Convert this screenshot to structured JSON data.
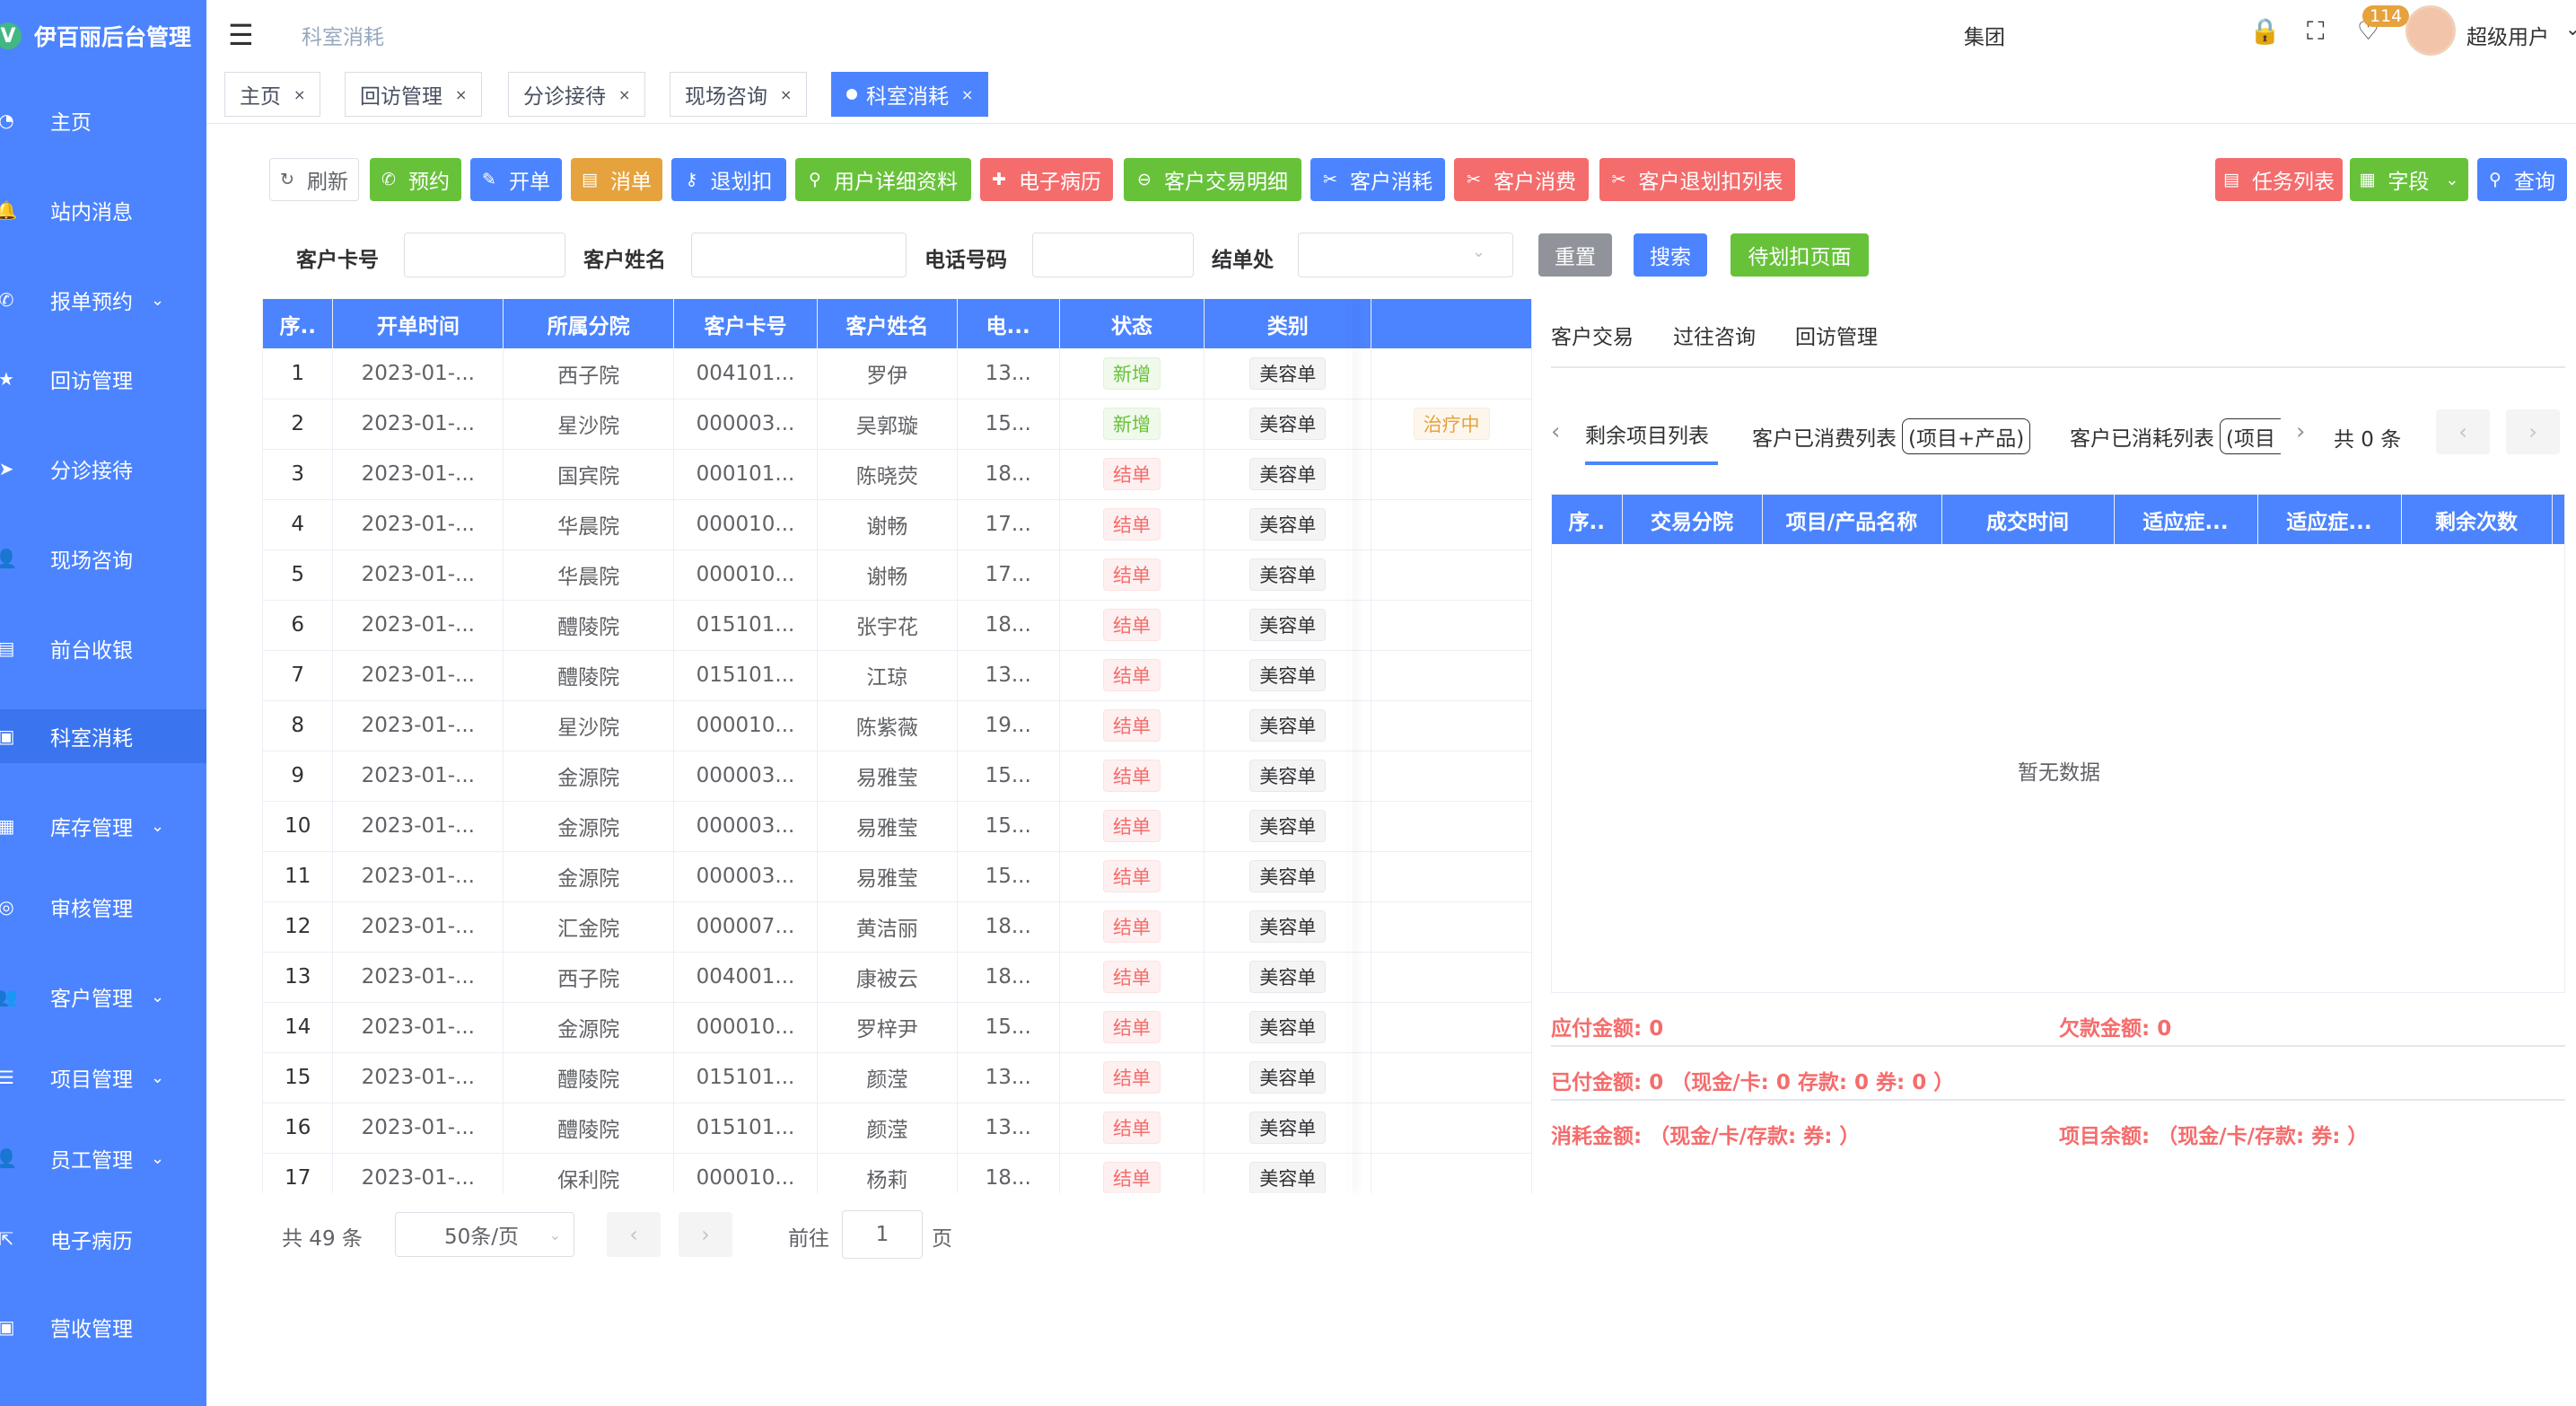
{
  "app": {
    "title": "伊百丽后台管理",
    "logo_letter": "V"
  },
  "sidebar": {
    "items": [
      {
        "label": "主页",
        "icon": "dashboard-icon",
        "glyph": "◔",
        "chev": ""
      },
      {
        "label": "站内消息",
        "icon": "bell-icon",
        "glyph": "🔔",
        "chev": ""
      },
      {
        "label": "报单预约",
        "icon": "phone-icon",
        "glyph": "✆",
        "chev": "⌄"
      },
      {
        "label": "回访管理",
        "icon": "star-icon",
        "glyph": "★",
        "chev": ""
      },
      {
        "label": "分诊接待",
        "icon": "send-icon",
        "glyph": "➤",
        "chev": ""
      },
      {
        "label": "现场咨询",
        "icon": "user-icon",
        "glyph": "👤",
        "chev": ""
      },
      {
        "label": "前台收银",
        "icon": "cashier-icon",
        "glyph": "▤",
        "chev": ""
      },
      {
        "label": "科室消耗",
        "icon": "monitor-icon",
        "glyph": "▣",
        "chev": ""
      },
      {
        "label": "库存管理",
        "icon": "grid-icon",
        "glyph": "▦",
        "chev": "⌄"
      },
      {
        "label": "审核管理",
        "icon": "chat-icon",
        "glyph": "◎",
        "chev": ""
      },
      {
        "label": "客户管理",
        "icon": "customers-icon",
        "glyph": "👥",
        "chev": "⌄"
      },
      {
        "label": "项目管理",
        "icon": "list-icon",
        "glyph": "☰",
        "chev": "⌄"
      },
      {
        "label": "员工管理",
        "icon": "staff-icon",
        "glyph": "👤",
        "chev": "⌄"
      },
      {
        "label": "电子病历",
        "icon": "external-link-icon",
        "glyph": "⇱",
        "chev": ""
      },
      {
        "label": "营收管理",
        "icon": "revenue-icon",
        "glyph": "▣",
        "chev": ""
      }
    ]
  },
  "header": {
    "breadcrumb": "科室消耗",
    "group_label": "集团",
    "badge_count": "114",
    "user_name": "超级用户"
  },
  "tags": [
    {
      "label": "主页"
    },
    {
      "label": "回访管理"
    },
    {
      "label": "分诊接待"
    },
    {
      "label": "现场咨询"
    },
    {
      "label": "科室消耗"
    }
  ],
  "toolbar": {
    "refresh": "刷新",
    "appointment": "预约",
    "open_order": "开单",
    "cancel_order": "消单",
    "refund_deduct": "退划扣",
    "user_detail": "用户详细资料",
    "emr": "电子病历",
    "trade_detail": "客户交易明细",
    "customer_consume": "客户消耗",
    "customer_spend": "客户消费",
    "refund_list": "客户退划扣列表",
    "task_list": "任务列表",
    "fields": "字段",
    "query": "查询"
  },
  "search": {
    "card_label": "客户卡号",
    "card_value": "",
    "name_label": "客户姓名",
    "name_value": "",
    "phone_label": "电话号码",
    "phone_value": "",
    "settle_label": "结单处",
    "settle_value": "",
    "reset": "重置",
    "search": "搜索",
    "pending": "待划扣页面"
  },
  "table": {
    "columns": [
      "序..",
      "开单时间",
      "所属分院",
      "客户卡号",
      "客户姓名",
      "电...",
      "状态",
      "类别",
      ""
    ],
    "rows": [
      {
        "no": "1",
        "time": "2023-01-...",
        "branch": "西子院",
        "card": "004101...",
        "name": "罗伊",
        "phone": "13...",
        "status": "新增",
        "status_type": "new",
        "cat": "美容单",
        "extra": ""
      },
      {
        "no": "2",
        "time": "2023-01-...",
        "branch": "星沙院",
        "card": "000003...",
        "name": "吴郭璇",
        "phone": "15...",
        "status": "新增",
        "status_type": "new",
        "cat": "美容单",
        "extra": "治疗中"
      },
      {
        "no": "3",
        "time": "2023-01-...",
        "branch": "国宾院",
        "card": "000101...",
        "name": "陈晓荧",
        "phone": "18...",
        "status": "结单",
        "status_type": "done",
        "cat": "美容单",
        "extra": ""
      },
      {
        "no": "4",
        "time": "2023-01-...",
        "branch": "华晨院",
        "card": "000010...",
        "name": "谢畅",
        "phone": "17...",
        "status": "结单",
        "status_type": "done",
        "cat": "美容单",
        "extra": ""
      },
      {
        "no": "5",
        "time": "2023-01-...",
        "branch": "华晨院",
        "card": "000010...",
        "name": "谢畅",
        "phone": "17...",
        "status": "结单",
        "status_type": "done",
        "cat": "美容单",
        "extra": ""
      },
      {
        "no": "6",
        "time": "2023-01-...",
        "branch": "醴陵院",
        "card": "015101...",
        "name": "张宇花",
        "phone": "18...",
        "status": "结单",
        "status_type": "done",
        "cat": "美容单",
        "extra": ""
      },
      {
        "no": "7",
        "time": "2023-01-...",
        "branch": "醴陵院",
        "card": "015101...",
        "name": "江琼",
        "phone": "13...",
        "status": "结单",
        "status_type": "done",
        "cat": "美容单",
        "extra": ""
      },
      {
        "no": "8",
        "time": "2023-01-...",
        "branch": "星沙院",
        "card": "000010...",
        "name": "陈紫薇",
        "phone": "19...",
        "status": "结单",
        "status_type": "done",
        "cat": "美容单",
        "extra": ""
      },
      {
        "no": "9",
        "time": "2023-01-...",
        "branch": "金源院",
        "card": "000003...",
        "name": "易雅莹",
        "phone": "15...",
        "status": "结单",
        "status_type": "done",
        "cat": "美容单",
        "extra": ""
      },
      {
        "no": "10",
        "time": "2023-01-...",
        "branch": "金源院",
        "card": "000003...",
        "name": "易雅莹",
        "phone": "15...",
        "status": "结单",
        "status_type": "done",
        "cat": "美容单",
        "extra": ""
      },
      {
        "no": "11",
        "time": "2023-01-...",
        "branch": "金源院",
        "card": "000003...",
        "name": "易雅莹",
        "phone": "15...",
        "status": "结单",
        "status_type": "done",
        "cat": "美容单",
        "extra": ""
      },
      {
        "no": "12",
        "time": "2023-01-...",
        "branch": "汇金院",
        "card": "000007...",
        "name": "黄洁丽",
        "phone": "18...",
        "status": "结单",
        "status_type": "done",
        "cat": "美容单",
        "extra": ""
      },
      {
        "no": "13",
        "time": "2023-01-...",
        "branch": "西子院",
        "card": "004001...",
        "name": "康被云",
        "phone": "18...",
        "status": "结单",
        "status_type": "done",
        "cat": "美容单",
        "extra": ""
      },
      {
        "no": "14",
        "time": "2023-01-...",
        "branch": "金源院",
        "card": "000010...",
        "name": "罗梓尹",
        "phone": "15...",
        "status": "结单",
        "status_type": "done",
        "cat": "美容单",
        "extra": ""
      },
      {
        "no": "15",
        "time": "2023-01-...",
        "branch": "醴陵院",
        "card": "015101...",
        "name": "颜滢",
        "phone": "13...",
        "status": "结单",
        "status_type": "done",
        "cat": "美容单",
        "extra": ""
      },
      {
        "no": "16",
        "time": "2023-01-...",
        "branch": "醴陵院",
        "card": "015101...",
        "name": "颜滢",
        "phone": "13...",
        "status": "结单",
        "status_type": "done",
        "cat": "美容单",
        "extra": ""
      },
      {
        "no": "17",
        "time": "2023-01-...",
        "branch": "保利院",
        "card": "000010...",
        "name": "杨莉",
        "phone": "18...",
        "status": "结单",
        "status_type": "done",
        "cat": "美容单",
        "extra": ""
      }
    ]
  },
  "pager": {
    "total": "共 49 条",
    "page_size": "50条/页",
    "goto": "前往",
    "current_page": "1",
    "page_suffix": "页"
  },
  "right_panel": {
    "tabs": [
      "客户交易",
      "过往咨询",
      "回访管理"
    ],
    "subtabs": {
      "remaining": "剩余项目列表",
      "consumed": "客户已消费列表",
      "consumed_pill": "(项目+产品)",
      "used": "客户已消耗列表",
      "used_pill": "(项目"
    },
    "count": "共 0 条",
    "columns": [
      "序..",
      "交易分院",
      "项目/产品名称",
      "成交时间",
      "适应症...",
      "适应症...",
      "剩余次数"
    ],
    "empty_text": "暂无数据",
    "summary": {
      "payable": "应付金额: 0",
      "arrears": "欠款金额: 0",
      "paid": "已付金额: 0 （现金/卡: 0   存款: 0   券: 0 ）",
      "consume": "消耗金额: （现金/卡/存款:  券: ）",
      "balance": "项目余额: （现金/卡/存款:  券: ）"
    }
  },
  "colors": {
    "primary": "#4c84ff",
    "success": "#67c23a",
    "warning": "#e6a23c",
    "danger": "#f56c6c",
    "info": "#909399"
  }
}
